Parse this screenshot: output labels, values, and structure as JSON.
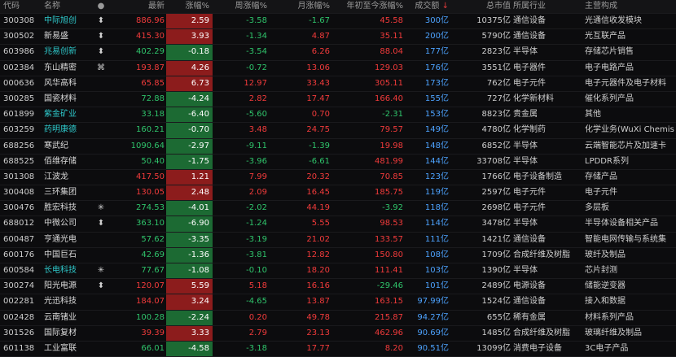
{
  "headers": {
    "code": "代码",
    "name": "名称",
    "mark": "●",
    "last": "最新",
    "chg": "涨幅%",
    "wk": "周涨幅%",
    "mo": "月涨幅%",
    "ytd": "年初至今涨幅%",
    "amt": "成交额",
    "sort_arrow": "↓",
    "cap": "总市值",
    "ind": "所属行业",
    "main": "主营构成"
  },
  "colors": {
    "up": "#f23b3b",
    "down": "#2fc46b",
    "accent": "#4da3ff",
    "highlight_name": "#2ec7c9"
  },
  "rows": [
    {
      "code": "300308",
      "name": "中际旭创",
      "mark": "⬍",
      "hl": true,
      "last": "886.96",
      "chg": "2.59",
      "wk": "-3.58",
      "mo": "-1.67",
      "ytd": "45.58",
      "amt": "300亿",
      "cap": "10375亿",
      "ind": "通信设备",
      "main": "光通信收发模块"
    },
    {
      "code": "300502",
      "name": "新易盛",
      "mark": "⬍",
      "hl": false,
      "last": "415.30",
      "chg": "3.93",
      "wk": "-1.34",
      "mo": "4.87",
      "ytd": "35.11",
      "amt": "200亿",
      "cap": "5790亿",
      "ind": "通信设备",
      "main": "光互联产品"
    },
    {
      "code": "603986",
      "name": "兆易创新",
      "mark": "⬍",
      "hl": true,
      "last": "402.29",
      "chg": "-0.18",
      "wk": "-3.54",
      "mo": "6.26",
      "ytd": "88.04",
      "amt": "177亿",
      "cap": "2823亿",
      "ind": "半导体",
      "main": "存储芯片销售"
    },
    {
      "code": "002384",
      "name": "东山精密",
      "mark": "⌘",
      "hl": false,
      "last": "193.87",
      "chg": "4.26",
      "wk": "-0.72",
      "mo": "13.06",
      "ytd": "129.03",
      "amt": "176亿",
      "cap": "3551亿",
      "ind": "电子器件",
      "main": "电子电路产品"
    },
    {
      "code": "000636",
      "name": "风华高科",
      "mark": "",
      "hl": false,
      "last": "65.85",
      "chg": "6.73",
      "wk": "12.97",
      "mo": "33.43",
      "ytd": "305.11",
      "amt": "173亿",
      "cap": "762亿",
      "ind": "电子元件",
      "main": "电子元器件及电子材料"
    },
    {
      "code": "300285",
      "name": "国瓷材料",
      "mark": "",
      "hl": false,
      "last": "72.88",
      "chg": "-4.24",
      "wk": "2.82",
      "mo": "17.47",
      "ytd": "166.40",
      "amt": "155亿",
      "cap": "727亿",
      "ind": "化学新材料",
      "main": "催化系列产品"
    },
    {
      "code": "601899",
      "name": "紫金矿业",
      "mark": "",
      "hl": true,
      "last": "33.18",
      "chg": "-6.40",
      "wk": "-5.60",
      "mo": "0.70",
      "ytd": "-2.31",
      "amt": "153亿",
      "cap": "8823亿",
      "ind": "贵金属",
      "main": "其他"
    },
    {
      "code": "603259",
      "name": "药明康德",
      "mark": "",
      "hl": true,
      "last": "160.21",
      "chg": "-0.70",
      "wk": "3.48",
      "mo": "24.75",
      "ytd": "79.57",
      "amt": "149亿",
      "cap": "4780亿",
      "ind": "化学制药",
      "main": "化学业务(WuXi Chemis"
    },
    {
      "code": "688256",
      "name": "寒武纪",
      "mark": "",
      "hl": false,
      "last": "1090.64",
      "chg": "-2.97",
      "wk": "-9.11",
      "mo": "-1.39",
      "ytd": "19.98",
      "amt": "148亿",
      "cap": "6852亿",
      "ind": "半导体",
      "main": "云端智能芯片及加速卡"
    },
    {
      "code": "688525",
      "name": "佰维存储",
      "mark": "",
      "hl": false,
      "last": "50.40",
      "chg": "-1.75",
      "wk": "-3.96",
      "mo": "-6.61",
      "ytd": "481.99",
      "amt": "144亿",
      "cap": "33708亿",
      "ind": "半导体",
      "main": "LPDDR系列"
    },
    {
      "code": "301308",
      "name": "江波龙",
      "mark": "",
      "hl": false,
      "last": "417.50",
      "chg": "1.21",
      "wk": "7.99",
      "mo": "20.32",
      "ytd": "70.85",
      "amt": "123亿",
      "cap": "1766亿",
      "ind": "电子设备制造",
      "main": "存储产品"
    },
    {
      "code": "300408",
      "name": "三环集团",
      "mark": "",
      "hl": false,
      "last": "130.05",
      "chg": "2.48",
      "wk": "2.09",
      "mo": "16.45",
      "ytd": "185.75",
      "amt": "119亿",
      "cap": "2597亿",
      "ind": "电子元件",
      "main": "电子元件"
    },
    {
      "code": "300476",
      "name": "胜宏科技",
      "mark": "✳",
      "hl": false,
      "last": "274.53",
      "chg": "-4.01",
      "wk": "-2.02",
      "mo": "44.19",
      "ytd": "-3.92",
      "amt": "118亿",
      "cap": "2698亿",
      "ind": "电子元件",
      "main": "多层板"
    },
    {
      "code": "688012",
      "name": "中微公司",
      "mark": "⬍",
      "hl": false,
      "last": "363.10",
      "chg": "-6.90",
      "wk": "-1.24",
      "mo": "5.55",
      "ytd": "98.53",
      "amt": "114亿",
      "cap": "3478亿",
      "ind": "半导体",
      "main": "半导体设备相关产品"
    },
    {
      "code": "600487",
      "name": "亨通光电",
      "mark": "",
      "hl": false,
      "last": "57.62",
      "chg": "-3.35",
      "wk": "-3.19",
      "mo": "21.02",
      "ytd": "133.57",
      "amt": "111亿",
      "cap": "1421亿",
      "ind": "通信设备",
      "main": "智能电网传输与系统集"
    },
    {
      "code": "600176",
      "name": "中国巨石",
      "mark": "",
      "hl": false,
      "last": "42.69",
      "chg": "-1.36",
      "wk": "-3.81",
      "mo": "12.82",
      "ytd": "150.80",
      "amt": "108亿",
      "cap": "1709亿",
      "ind": "合成纤维及树脂",
      "main": "玻纤及制品"
    },
    {
      "code": "600584",
      "name": "长电科技",
      "mark": "✳",
      "hl": true,
      "last": "77.67",
      "chg": "-1.08",
      "wk": "-0.10",
      "mo": "18.20",
      "ytd": "111.41",
      "amt": "103亿",
      "cap": "1390亿",
      "ind": "半导体",
      "main": "芯片封测"
    },
    {
      "code": "300274",
      "name": "阳光电源",
      "mark": "⬍",
      "hl": false,
      "last": "120.07",
      "chg": "5.59",
      "wk": "5.18",
      "mo": "16.16",
      "ytd": "-29.46",
      "amt": "101亿",
      "cap": "2489亿",
      "ind": "电源设备",
      "main": "储能逆变器"
    },
    {
      "code": "002281",
      "name": "光迅科技",
      "mark": "",
      "hl": false,
      "last": "184.07",
      "chg": "3.24",
      "wk": "-4.65",
      "mo": "13.87",
      "ytd": "163.15",
      "amt": "97.99亿",
      "cap": "1524亿",
      "ind": "通信设备",
      "main": "接入和数据"
    },
    {
      "code": "002428",
      "name": "云南锗业",
      "mark": "",
      "hl": false,
      "last": "100.28",
      "chg": "-2.24",
      "wk": "0.20",
      "mo": "49.78",
      "ytd": "215.87",
      "amt": "94.27亿",
      "cap": "655亿",
      "ind": "稀有金属",
      "main": "材料系列产品"
    },
    {
      "code": "301526",
      "name": "国际复材",
      "mark": "",
      "hl": false,
      "last": "39.39",
      "chg": "3.33",
      "wk": "2.79",
      "mo": "23.13",
      "ytd": "462.96",
      "amt": "90.69亿",
      "cap": "1485亿",
      "ind": "合成纤维及树脂",
      "main": "玻璃纤维及制品"
    },
    {
      "code": "601138",
      "name": "工业富联",
      "mark": "",
      "hl": false,
      "last": "66.01",
      "chg": "-4.58",
      "wk": "-3.18",
      "mo": "17.77",
      "ytd": "8.20",
      "amt": "90.51亿",
      "cap": "13099亿",
      "ind": "消费电子设备",
      "main": "3C电子产品"
    }
  ]
}
